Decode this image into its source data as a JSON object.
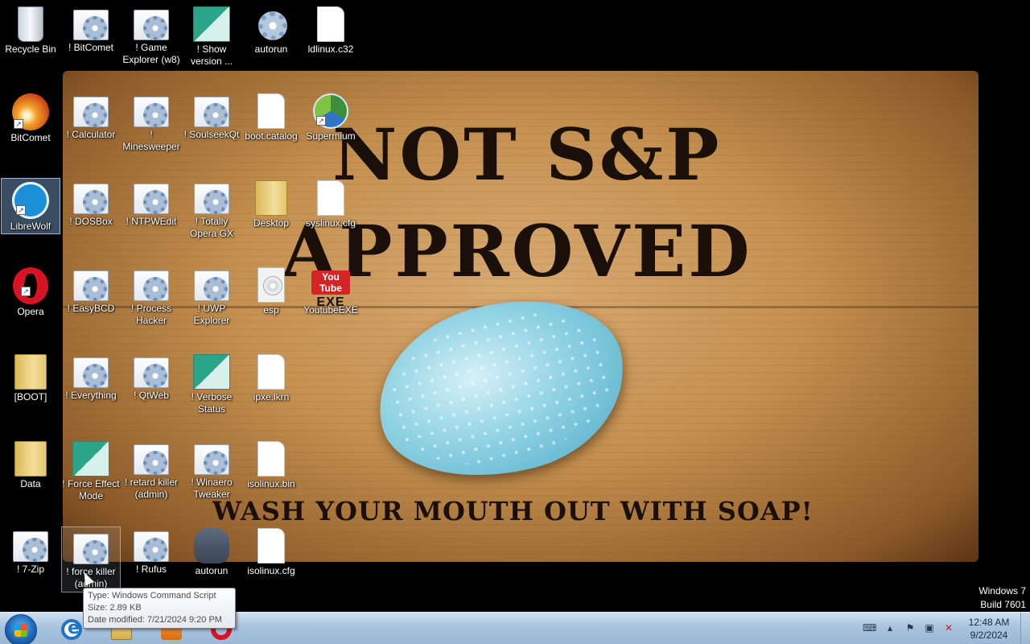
{
  "wallpaper": {
    "line1": "NOT S&P",
    "line2": "APPROVED",
    "line3": "WASH YOUR MOUTH OUT WITH SOAP!"
  },
  "desktop_icons": {
    "recycle_bin": "Recycle Bin",
    "bitcomet_app": "BitComet",
    "librewolf": "LibreWolf",
    "opera": "Opera",
    "boot": "[BOOT]",
    "data": "Data",
    "seven_zip": "! 7-Zip",
    "c2": [
      "! BitComet",
      "! Calculator",
      "! DOSBox",
      "! EasyBCD",
      "! Everything",
      "! Force Effect Mode",
      "! force killer (admin)"
    ],
    "c3": [
      "! Game Explorer (w8)",
      "! Minesweeper",
      "! NTPWEdit",
      "! Process Hacker",
      "! QtWeb",
      "! retard killer (admin)",
      "! Rufus"
    ],
    "c4": [
      "! Show version ...",
      "! SoulseekQt",
      "! Totally Opera GX",
      "! UWP Explorer",
      "! Verbose Status",
      "! Winaero Tweaker",
      "autorun"
    ],
    "c5": [
      "autorun",
      "boot.catalog",
      "Desktop",
      "esp",
      "ipxe.lkrn",
      "isolinux.bin",
      "isolinux.cfg"
    ],
    "c6": [
      "ldlinux.c32",
      "Supermium",
      "syslinux.cfg",
      "YoutubeEXE"
    ],
    "yt_logo_top": "You Tube",
    "yt_logo_bottom": "EXE"
  },
  "tooltip": {
    "type": "Type: Windows Command Script",
    "size": "Size: 2.89 KB",
    "modified": "Date modified: 7/21/2024 9:20 PM"
  },
  "watermark": {
    "os": "Windows 7",
    "build": "Build 7601"
  },
  "taskbar": {
    "time": "12:48 AM",
    "date": "9/2/2024",
    "pinned": [
      "internet-explorer-icon",
      "windows-explorer-icon",
      "media-player-icon",
      "opera-icon"
    ]
  }
}
